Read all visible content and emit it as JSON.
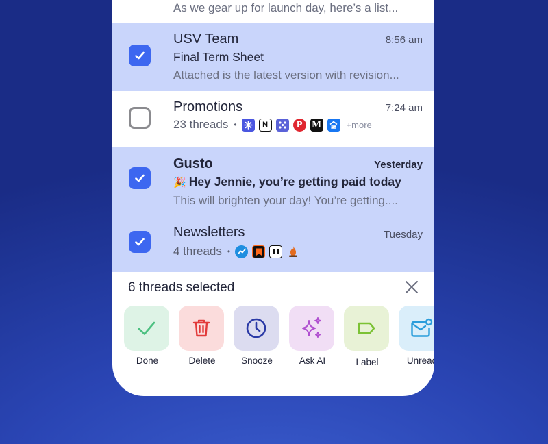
{
  "previous_row": {
    "preview": "As we gear up for launch day, here’s a list..."
  },
  "threads": [
    {
      "sender": "USV Team",
      "time": "8:56 am",
      "subject": "Final Term Sheet",
      "preview": "Attached is the latest version with revision...",
      "selected": true,
      "unread": false
    },
    {
      "sender": "Promotions",
      "time": "7:24 am",
      "thread_count": "23 threads",
      "more": "+more",
      "selected": false,
      "senders_icons": [
        "asterisk-logo-icon",
        "notion-logo-icon",
        "dots-logo-icon",
        "pinterest-logo-icon",
        "medium-logo-icon",
        "zillow-logo-icon"
      ]
    },
    {
      "sender": "Gusto",
      "time": "Yesterday",
      "subject_emoji": "🎉",
      "subject": "Hey Jennie, you’re getting paid today",
      "preview": "This will brighten your day! You’re getting....",
      "selected": true,
      "unread": true
    },
    {
      "sender": "Newsletters",
      "time": "Tuesday",
      "thread_count": "4 threads",
      "selected": true,
      "senders_icons": [
        "chart-logo-icon",
        "bookmark-logo-icon",
        "quote-logo-icon",
        "fire-logo-icon"
      ]
    }
  ],
  "selection_bar": {
    "title": "6 threads selected"
  },
  "actions": [
    {
      "label": "Done",
      "icon": "check-icon",
      "bg": "#def3e6",
      "color": "#4cc081"
    },
    {
      "label": "Delete",
      "icon": "trash-icon",
      "bg": "#fbdcdc",
      "color": "#e23a3a"
    },
    {
      "label": "Snooze",
      "icon": "clock-icon",
      "bg": "#dcdcf0",
      "color": "#2b3aa6"
    },
    {
      "label": "Ask AI",
      "icon": "sparkles-icon",
      "bg": "#f1def5",
      "color": "#b04fd0"
    },
    {
      "label": "Label",
      "icon": "tag-icon",
      "bg": "#e8f2d6",
      "color": "#7cc235"
    },
    {
      "label": "Unread",
      "icon": "mail-unread-icon",
      "bg": "#daeefa",
      "color": "#2a9ddb"
    }
  ],
  "colors": {
    "accent": "#3d67f0",
    "selected_row": "#c9d5fb"
  }
}
